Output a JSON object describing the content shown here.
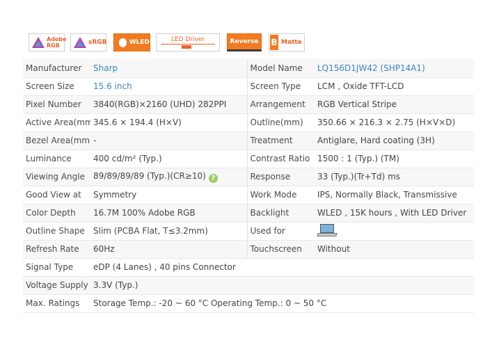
{
  "badges": {
    "adobe_line1": "Adobe",
    "adobe_line2": "RGB",
    "srgb": "sRGB",
    "wled": "WLED",
    "led_driver": "LED Driver",
    "reverse": "Reverse",
    "matte_letter": "B",
    "matte": "Matte"
  },
  "colors": {
    "accent": "#f07b20",
    "link": "#3a86c0"
  },
  "rows": [
    {
      "l1": "Manufacturer",
      "v1": "Sharp",
      "l2": "Model Name",
      "v2": "LQ156D1JW42 (SHP14A1)"
    },
    {
      "l1": "Screen Size",
      "v1": "15.6 inch",
      "l2": "Screen Type",
      "v2": "LCM ,   Oxide TFT-LCD"
    },
    {
      "l1": "Pixel Number",
      "v1": "3840(RGB)×2160   (UHD)  282PPI",
      "l2": "Arrangement",
      "v2": "RGB Vertical Stripe"
    },
    {
      "l1": "Active Area(mm)",
      "v1": "345.6 × 194.4 (H×V)",
      "l2": "Outline(mm)",
      "v2": "350.66 × 216.3 × 2.75 (H×V×D)"
    },
    {
      "l1": "Bezel Area(mm)",
      "v1": "-",
      "l2": "Treatment",
      "v2": "Antiglare, Hard coating (3H)"
    },
    {
      "l1": "Luminance",
      "v1": "400 cd/m² (Typ.)",
      "l2": "Contrast Ratio",
      "v2": "1500 : 1 (Typ.) (TM)"
    },
    {
      "l1": "Viewing Angle",
      "v1": "89/89/89/89 (Typ.)(CR≥10)",
      "l2": "Response",
      "v2": "33 (Typ.)(Tr+Td) ms"
    },
    {
      "l1": "Good View at",
      "v1": "Symmetry",
      "l2": "Work Mode",
      "v2": "IPS, Normally Black, Transmissive"
    },
    {
      "l1": "Color Depth",
      "v1": "16.7M   100% Adobe RGB",
      "l2": "Backlight",
      "v2": "WLED , 15K hours , With LED Driver"
    },
    {
      "l1": "Outline Shape",
      "v1": "Slim (PCBA Flat, T≤3.2mm)",
      "l2": "Used for",
      "v2": ""
    },
    {
      "l1": "Refresh Rate",
      "v1": "60Hz",
      "l2": "Touchscreen",
      "v2": "Without"
    },
    {
      "l1": "Signal Type",
      "v1": "eDP (4 Lanes) , 40 pins Connector"
    },
    {
      "l1": "Voltage Supply",
      "v1": "3.3V (Typ.)"
    },
    {
      "l1": "Max. Ratings",
      "v1": "Storage Temp.: -20 ~ 60 °C    Operating Temp.: 0 ~ 50 °C"
    }
  ],
  "icons": {
    "help": "question-mark-icon",
    "used_for": "laptop-icon"
  },
  "help_glyph": "?"
}
